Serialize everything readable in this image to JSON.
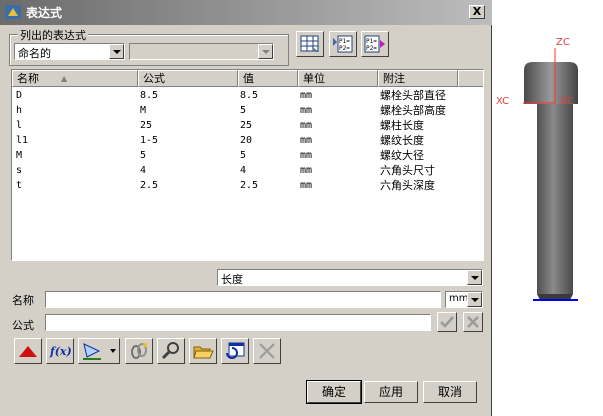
{
  "window": {
    "title": "表达式",
    "close_glyph": "X"
  },
  "list_expressions": {
    "group_label": "列出的表达式",
    "filter_value": "命名的",
    "second_value": ""
  },
  "table": {
    "headers": [
      "名称",
      "公式",
      "值",
      "单位",
      "附注"
    ],
    "sort_glyph": "▲",
    "rows": [
      [
        "D",
        "8.5",
        "8.5",
        "mm",
        "螺栓头部直径"
      ],
      [
        "h",
        "M",
        "5",
        "mm",
        "螺栓头部高度"
      ],
      [
        "l",
        "25",
        "25",
        "mm",
        "螺柱长度"
      ],
      [
        "l1",
        "1-5",
        "20",
        "mm",
        "螺纹长度"
      ],
      [
        "M",
        "5",
        "5",
        "mm",
        "螺纹大径"
      ],
      [
        "s",
        "4",
        "4",
        "mm",
        "六角头尺寸"
      ],
      [
        "t",
        "2.5",
        "2.5",
        "mm",
        "六角头深度"
      ]
    ]
  },
  "type_select": {
    "value": "长度"
  },
  "name_row": {
    "label": "名称",
    "value": "",
    "unit": "mm"
  },
  "formula_row": {
    "label": "公式",
    "value": ""
  },
  "toolbar": {
    "fx_label": "f(x)",
    "p1": "P1=",
    "p2": "P2="
  },
  "buttons": {
    "ok": "确定",
    "apply": "应用",
    "cancel": "取消"
  },
  "viewport": {
    "zc_top": "ZC",
    "xc_label": "XC",
    "zc_mid": "ZC"
  }
}
